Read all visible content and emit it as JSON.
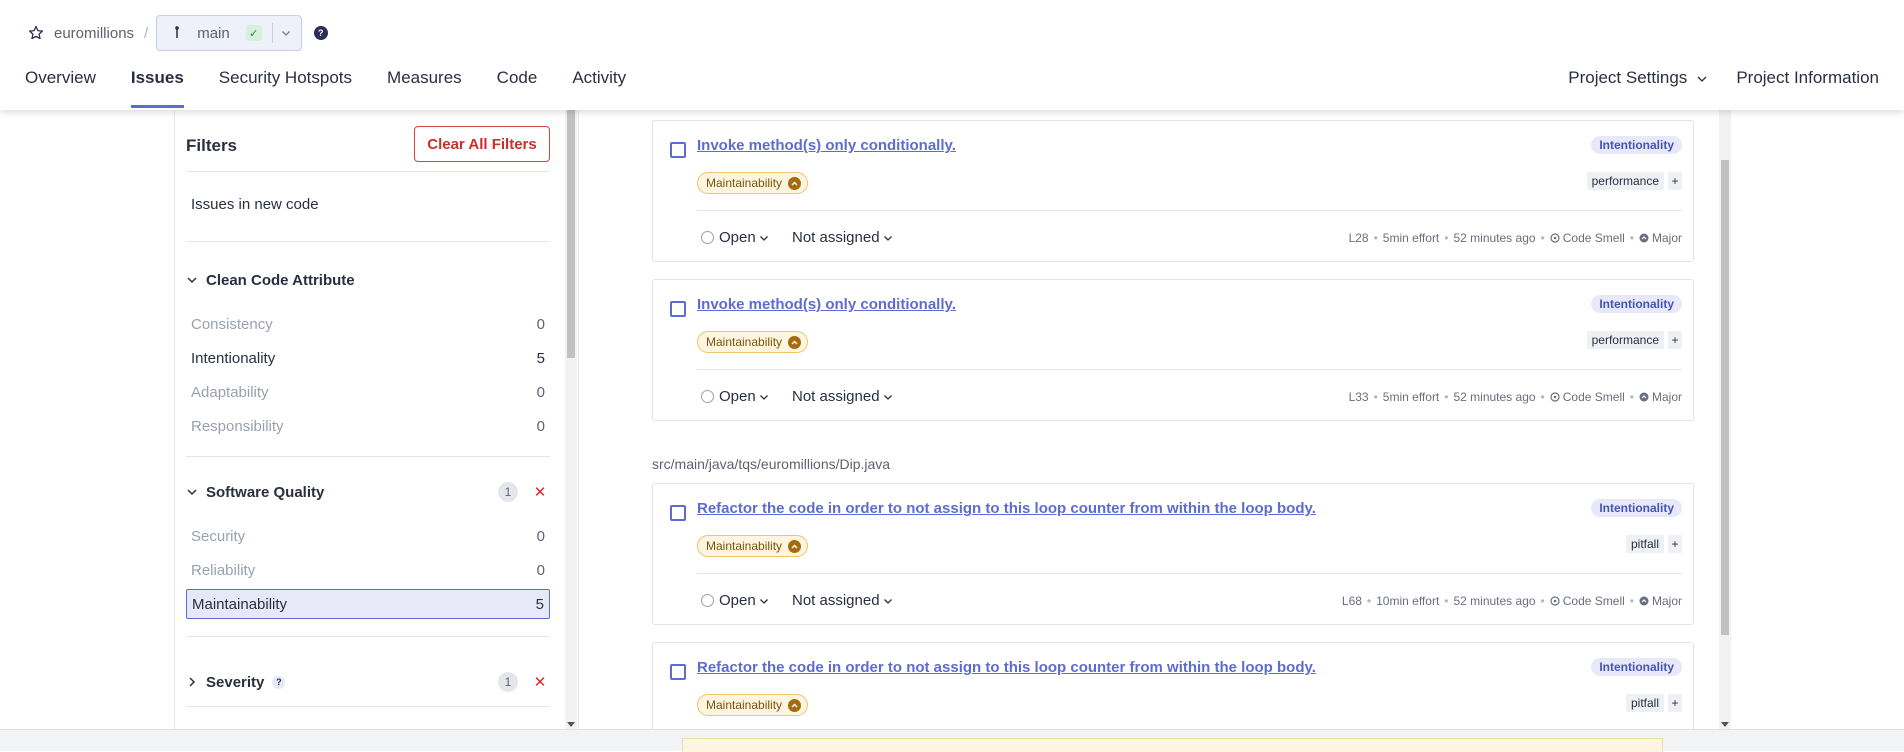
{
  "breadcrumb": {
    "project": "euromillions",
    "separator": "/",
    "branch": "main",
    "help": "?"
  },
  "nav": {
    "tabs": [
      "Overview",
      "Issues",
      "Security Hotspots",
      "Measures",
      "Code",
      "Activity"
    ],
    "active": "Issues",
    "right": {
      "settings": "Project Settings",
      "information": "Project Information"
    }
  },
  "filters": {
    "title": "Filters",
    "clear": "Clear All Filters",
    "new_code": "Issues in new code",
    "clean_code": {
      "title": "Clean Code Attribute",
      "items": [
        {
          "name": "Consistency",
          "count": "0"
        },
        {
          "name": "Intentionality",
          "count": "5"
        },
        {
          "name": "Adaptability",
          "count": "0"
        },
        {
          "name": "Responsibility",
          "count": "0"
        }
      ]
    },
    "software_quality": {
      "title": "Software Quality",
      "active_count": "1",
      "items": [
        {
          "name": "Security",
          "count": "0"
        },
        {
          "name": "Reliability",
          "count": "0"
        },
        {
          "name": "Maintainability",
          "count": "5"
        }
      ]
    },
    "severity": {
      "title": "Severity",
      "help": "?",
      "active_count": "1"
    }
  },
  "issues": {
    "file_path": "src/main/java/tqs/euromillions/Dip.java",
    "cards": [
      {
        "message": "Invoke method(s) only conditionally.",
        "attribute": "Intentionality",
        "quality": "Maintainability",
        "tag": "performance",
        "plus": "+",
        "status": "Open",
        "assignee": "Not assigned",
        "line": "L28",
        "effort": "5min effort",
        "age": "52 minutes ago",
        "type": "Code Smell",
        "severity": "Major"
      },
      {
        "message": "Invoke method(s) only conditionally.",
        "attribute": "Intentionality",
        "quality": "Maintainability",
        "tag": "performance",
        "plus": "+",
        "status": "Open",
        "assignee": "Not assigned",
        "line": "L33",
        "effort": "5min effort",
        "age": "52 minutes ago",
        "type": "Code Smell",
        "severity": "Major"
      },
      {
        "message": "Refactor the code in order to not assign to this loop counter from within the loop body.",
        "attribute": "Intentionality",
        "quality": "Maintainability",
        "tag": "pitfall",
        "plus": "+",
        "status": "Open",
        "assignee": "Not assigned",
        "line": "L68",
        "effort": "10min effort",
        "age": "52 minutes ago",
        "type": "Code Smell",
        "severity": "Major"
      },
      {
        "message": "Refactor the code in order to not assign to this loop counter from within the loop body.",
        "attribute": "Intentionality",
        "quality": "Maintainability",
        "tag": "pitfall",
        "plus": "+"
      }
    ]
  },
  "colors": {
    "accent": "#5d6cd0",
    "danger": "#c9302c",
    "quality_bg": "#fdf5df"
  },
  "icons": {
    "star": "star-icon",
    "branch": "branch-icon",
    "check": "check-icon",
    "chevron": "chevron-down-icon",
    "close": "close-icon",
    "code_smell": "code-smell-icon",
    "major": "severity-major-icon"
  }
}
